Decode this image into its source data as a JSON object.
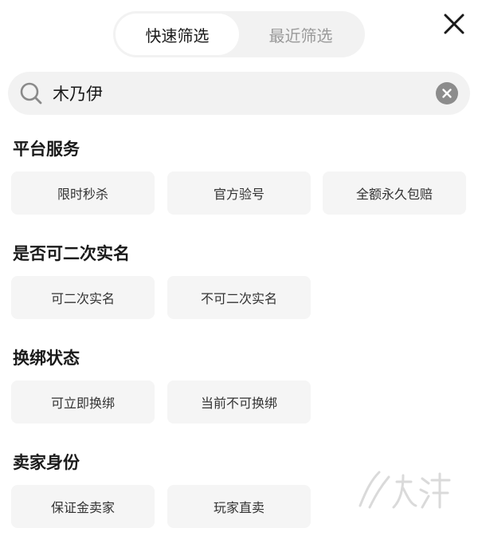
{
  "tabs": [
    {
      "label": "快速筛选",
      "active": true
    },
    {
      "label": "最近筛选",
      "active": false
    }
  ],
  "search": {
    "value": "木乃伊"
  },
  "sections": [
    {
      "title": "平台服务",
      "options": [
        "限时秒杀",
        "官方验号",
        "全额永久包赔"
      ]
    },
    {
      "title": "是否可二次实名",
      "options": [
        "可二次实名",
        "不可二次实名"
      ]
    },
    {
      "title": "换绑状态",
      "options": [
        "可立即换绑",
        "当前不可换绑"
      ]
    },
    {
      "title": "卖家身份",
      "options": [
        "保证金卖家",
        "玩家直卖"
      ]
    }
  ],
  "icons": {
    "close": "close-icon",
    "search": "search-icon",
    "clear": "clear-icon"
  },
  "colors": {
    "chip_bg": "#f5f5f5",
    "search_bg": "#f2f2f2",
    "inactive_tab": "#9a9a9a"
  }
}
